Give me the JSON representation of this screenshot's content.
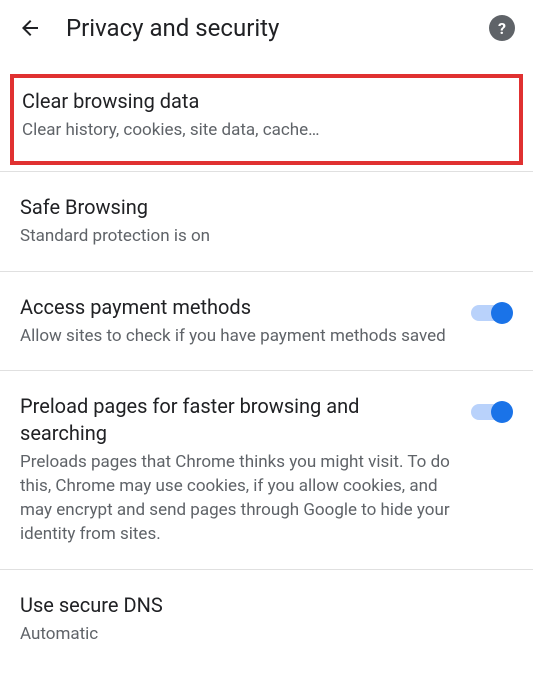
{
  "header": {
    "title": "Privacy and security"
  },
  "items": {
    "clear_data": {
      "title": "Clear browsing data",
      "subtitle": "Clear history, cookies, site data, cache…"
    },
    "safe_browsing": {
      "title": "Safe Browsing",
      "subtitle": "Standard protection is on"
    },
    "payment": {
      "title": "Access payment methods",
      "subtitle": "Allow sites to check if you have payment methods saved"
    },
    "preload": {
      "title": "Preload pages for faster browsing and searching",
      "subtitle": "Preloads pages that Chrome thinks you might visit. To do this, Chrome may use cookies, if you allow cookies, and may encrypt and send pages through Google to hide your identity from sites."
    },
    "dns": {
      "title": "Use secure DNS",
      "subtitle": "Automatic"
    }
  }
}
